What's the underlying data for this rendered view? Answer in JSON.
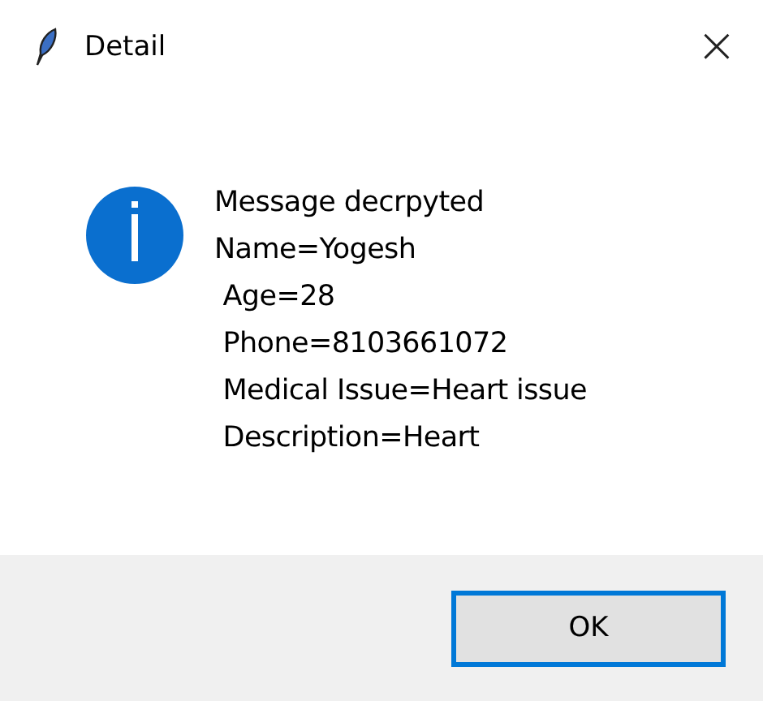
{
  "window": {
    "title": "Detail",
    "close": "×"
  },
  "message": "Message decrpyted\nName=Yogesh\n Age=28\n Phone=8103661072\n Medical Issue=Heart issue\n Description=Heart",
  "buttons": [
    {
      "label": "OK",
      "focused": true
    }
  ]
}
